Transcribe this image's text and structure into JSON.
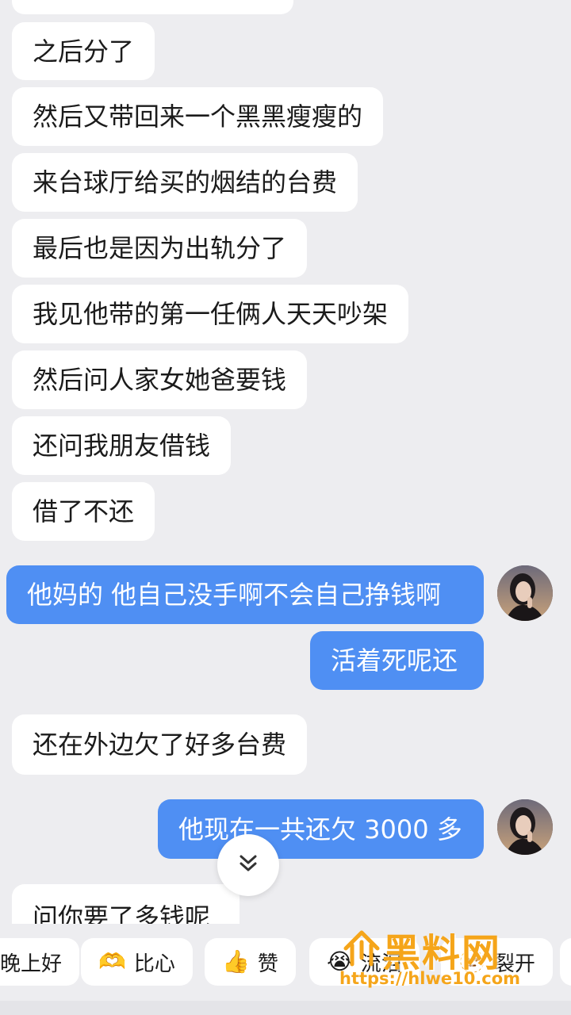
{
  "messages": [
    {
      "side": "in",
      "text": ""
    },
    {
      "side": "in",
      "text": "之后分了"
    },
    {
      "side": "in",
      "text": "然后又带回来一个黑黑瘦瘦的"
    },
    {
      "side": "in",
      "text": "来台球厅给买的烟结的台费"
    },
    {
      "side": "in",
      "text": "最后也是因为出轨分了"
    },
    {
      "side": "in",
      "text": "我见他带的第一任俩人天天吵架"
    },
    {
      "side": "in",
      "text": "然后问人家女她爸要钱"
    },
    {
      "side": "in",
      "text": "还问我朋友借钱"
    },
    {
      "side": "in",
      "text": "借了不还"
    },
    {
      "side": "out",
      "text": "他妈的 他自己没手啊不会自己挣钱啊"
    },
    {
      "side": "out",
      "text": "活着死呢还"
    },
    {
      "side": "in",
      "text": "还在外边欠了好多台费"
    },
    {
      "side": "out",
      "text": "他现在一共还欠 3000 多"
    },
    {
      "side": "in",
      "text": "问你要了多钱呢"
    }
  ],
  "quick_replies": [
    {
      "label": "晚上好",
      "icon": ""
    },
    {
      "label": "比心",
      "icon": "heart-hands-icon"
    },
    {
      "label": "赞",
      "icon": "thumbs-up-icon"
    },
    {
      "label": "流泪",
      "icon": "crying-face-icon"
    },
    {
      "label": "裂开",
      "icon": "cracked-face-icon"
    }
  ],
  "emoji": {
    "heart": "🫶",
    "thumb": "👍",
    "cry": "😭",
    "crack": "🫥"
  },
  "watermark": {
    "title": "黑料网",
    "url": "https://hlwe10.com"
  },
  "colors": {
    "outgoing": "#4f8ff3",
    "incoming": "#ffffff",
    "background": "#ededf0",
    "watermark": "#f5a51a"
  }
}
